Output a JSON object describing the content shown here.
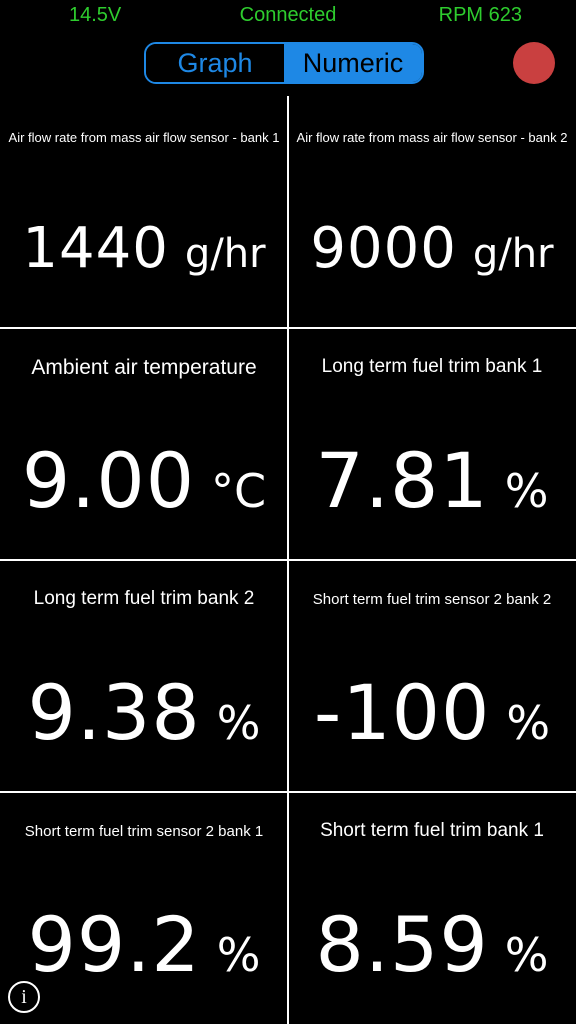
{
  "status": {
    "voltage": "14.5V",
    "connection": "Connected",
    "rpm": "RPM 623"
  },
  "toggle": {
    "graph_label": "Graph",
    "numeric_label": "Numeric",
    "selected": "Numeric"
  },
  "colors": {
    "status_green": "#2ecc2e",
    "accent_blue": "#1e88e5",
    "record_red": "#c94040"
  },
  "cells": [
    {
      "label": "Air flow rate from mass air flow sensor - bank 1",
      "value": "1440",
      "unit": "g/hr"
    },
    {
      "label": "Air flow rate from mass air flow sensor - bank 2",
      "value": "9000",
      "unit": "g/hr"
    },
    {
      "label": "Ambient air temperature",
      "value": "9.00",
      "unit": "°C"
    },
    {
      "label": "Long term fuel trim bank 1",
      "value": "7.81",
      "unit": "%"
    },
    {
      "label": "Long term fuel trim bank 2",
      "value": "9.38",
      "unit": "%"
    },
    {
      "label": "Short term fuel trim sensor 2 bank 2",
      "value": "-100",
      "unit": "%"
    },
    {
      "label": "Short term fuel trim sensor 2 bank 1",
      "value": "99.2",
      "unit": "%"
    },
    {
      "label": "Short term fuel trim bank 1",
      "value": "8.59",
      "unit": "%"
    }
  ],
  "icons": {
    "record": "record-icon",
    "info": "info-icon"
  }
}
